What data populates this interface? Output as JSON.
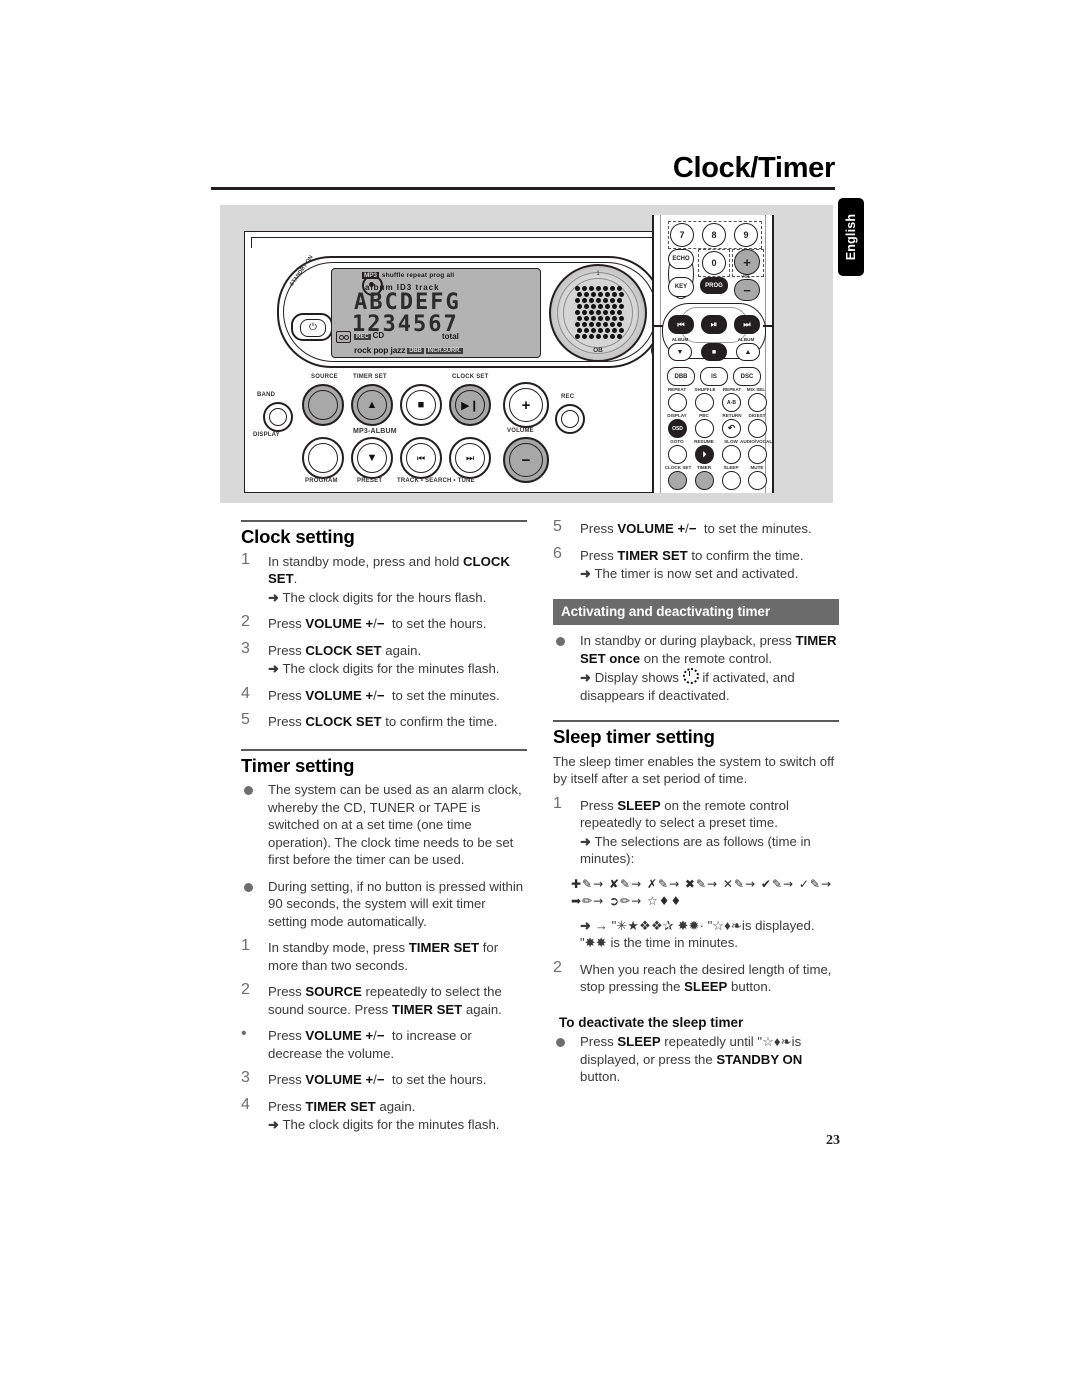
{
  "header": {
    "title": "Clock/Timer",
    "language_tab": "English"
  },
  "page_number": "23",
  "illustration": {
    "device": {
      "standby_label": "STANDBY-ON",
      "brand_mark": "Y",
      "ir_label": "IR",
      "lcd": {
        "mp3_badge": "MP3",
        "indicators_top": "shuffle repeat prog all",
        "indicators_sub": "album  ID3  track",
        "main_text": "ABCDEFG",
        "digits": "1234567",
        "total": "total",
        "rec": "REC",
        "cd": "CD",
        "modes": "rock pop jazz",
        "tag_dbb": "DBB",
        "tag_surr": "INCR.SURR.",
        "speaker_label": "OB",
        "speaker_top": "1"
      },
      "buttons": [
        {
          "name": "source",
          "label": "SOURCE",
          "glyph": ""
        },
        {
          "name": "timer-set",
          "label": "TIMER SET",
          "glyph": "▲"
        },
        {
          "name": "stop",
          "label": "",
          "glyph": "■"
        },
        {
          "name": "clock-set",
          "label": "CLOCK SET",
          "glyph": "▶❙"
        },
        {
          "name": "volume-plus",
          "label": "",
          "glyph": "+"
        },
        {
          "name": "band",
          "label": "BAND",
          "glyph": ""
        },
        {
          "name": "display",
          "label": "DISPLAY",
          "glyph": ""
        },
        {
          "name": "program",
          "label": "PROGRAM",
          "glyph": ""
        },
        {
          "name": "preset",
          "label": "PRESET",
          "glyph": "▼"
        },
        {
          "name": "prev",
          "label": "",
          "glyph": "⏮"
        },
        {
          "name": "next",
          "label": "",
          "glyph": "⏭"
        },
        {
          "name": "volume-minus",
          "label": "",
          "glyph": "−"
        },
        {
          "name": "rec",
          "label": "REC",
          "glyph": ""
        }
      ],
      "labels": {
        "mp3_album": "MP3-ALBUM",
        "volume": "VOLUME",
        "track_search_tune": "TRACK • SEARCH • TUNE"
      }
    },
    "remote": {
      "numeric": [
        "7",
        "8",
        "9",
        "0"
      ],
      "echo": "ECHO",
      "key": "KEY",
      "prog": "PROG",
      "vol": "VOL",
      "vol_plus": "+",
      "vol_minus": "−",
      "album_left": "ALBUM",
      "album_right": "ALBUM",
      "row_main": [
        "DBB",
        "IS",
        "DSC"
      ],
      "grid": [
        [
          "REPEAT",
          "SHUFFLE",
          "REPEAT",
          "MIX SEL"
        ],
        [
          "DISPLAY",
          "PBC",
          "RETURN",
          "DIGEST"
        ],
        [
          "GOTO",
          "RESUME",
          "SLOW",
          "AUDIO/VOCAL"
        ],
        [
          "CLOCK SET",
          "TIMER",
          "SLEEP",
          "MUTE"
        ]
      ],
      "grid_inner": [
        "A-B",
        "OSD"
      ]
    }
  },
  "left_column": {
    "clock_setting": {
      "heading": "Clock setting",
      "steps": [
        {
          "num": "1",
          "text_html": "In standby mode, press and hold <b>CLOCK SET</b>.",
          "arrow": "The clock digits for the hours flash."
        },
        {
          "num": "2",
          "text_html": "Press <b>VOLUME</b> <b>&#43;</b>/<b>&#8722;</b>&nbsp; to set the hours.",
          "arrow": ""
        },
        {
          "num": "3",
          "text_html": "Press <b>CLOCK SET</b> again.",
          "arrow": "The clock digits for the minutes flash."
        },
        {
          "num": "4",
          "text_html": "Press <b>VOLUME</b> <b>&#43;</b>/<b>&#8722;</b>&nbsp; to set the minutes.",
          "arrow": ""
        },
        {
          "num": "5",
          "text_html": "Press <b>CLOCK SET</b> to confirm the time.",
          "arrow": ""
        }
      ]
    },
    "timer_setting": {
      "heading": "Timer setting",
      "bullets": [
        "The system can be used as an alarm clock, whereby the CD, TUNER or TAPE is switched on at a set time (one time operation). The clock time needs to be set first before the timer can be used.",
        "During setting, if no button is pressed within 90 seconds, the system will exit timer setting mode automatically."
      ],
      "steps": [
        {
          "num": "1",
          "text_html": "In standby mode, press <b>TIMER SET</b> for more than two seconds.",
          "arrow": ""
        },
        {
          "num": "2",
          "text_html": "Press <b>SOURCE</b> repeatedly to select the sound source. Press <b>TIMER SET</b> again.",
          "arrow": ""
        },
        {
          "num": "•",
          "text_html": "Press <b>VOLUME</b> <b>&#43;</b>/<b>&#8722;</b>&nbsp; to increase or decrease the volume.",
          "arrow": ""
        },
        {
          "num": "3",
          "text_html": "Press <b>VOLUME</b> <b>&#43;</b>/<b>&#8722;</b>&nbsp; to set the hours.",
          "arrow": ""
        },
        {
          "num": "4",
          "text_html": "Press <b>TIMER SET</b> again.",
          "arrow": "The clock digits for the minutes flash."
        }
      ]
    }
  },
  "right_column": {
    "timer_steps_continued": [
      {
        "num": "5",
        "text_html": "Press <b>VOLUME</b> <b>&#43;</b>/<b>&#8722;</b>&nbsp; to set the minutes.",
        "arrow": ""
      },
      {
        "num": "6",
        "text_html": "Press <b>TIMER SET</b> to confirm the time.",
        "arrow": "The timer is now set and activated."
      }
    ],
    "activating_bar": "Activating and deactivating timer",
    "activating_bullet_html": "In standby or during playback, press <b>TIMER SET once</b> on the remote control.",
    "activating_arrow_pre": "Display shows",
    "activating_arrow_post": "if activated, and disappears if deactivated.",
    "sleep_timer": {
      "heading": "Sleep timer setting",
      "intro": "The sleep timer enables the system to switch off by itself after a set period of time.",
      "steps": [
        {
          "num": "1",
          "text_html": "Press <b>SLEEP</b> on the remote control repeatedly to select a preset time.",
          "arrow": "The selections are as follows (time in minutes):"
        }
      ],
      "dingbat_line_1": "✚✎→ ✘✎→ ✗✎→ ✖✎→ ✕✎→ ✔✎→ ✓✎→",
      "dingbat_line_2": "➡✏→ ➲✏→ ☆♦♦",
      "dingbat_arrow_html": "→ \"✳★❖❖✰ ✸✹· \"☆♦❧is displayed. \"✸✸ is the time in minutes.",
      "step2": {
        "num": "2",
        "text_html": "When you reach the desired length of time, stop pressing the <b>SLEEP</b> button."
      },
      "deactivate_heading": "To deactivate the sleep timer",
      "deactivate_bullet_html": "Press <b>SLEEP</b> repeatedly until \"☆♦❧is displayed, or press the <b>STANDBY ON</b> button."
    }
  }
}
